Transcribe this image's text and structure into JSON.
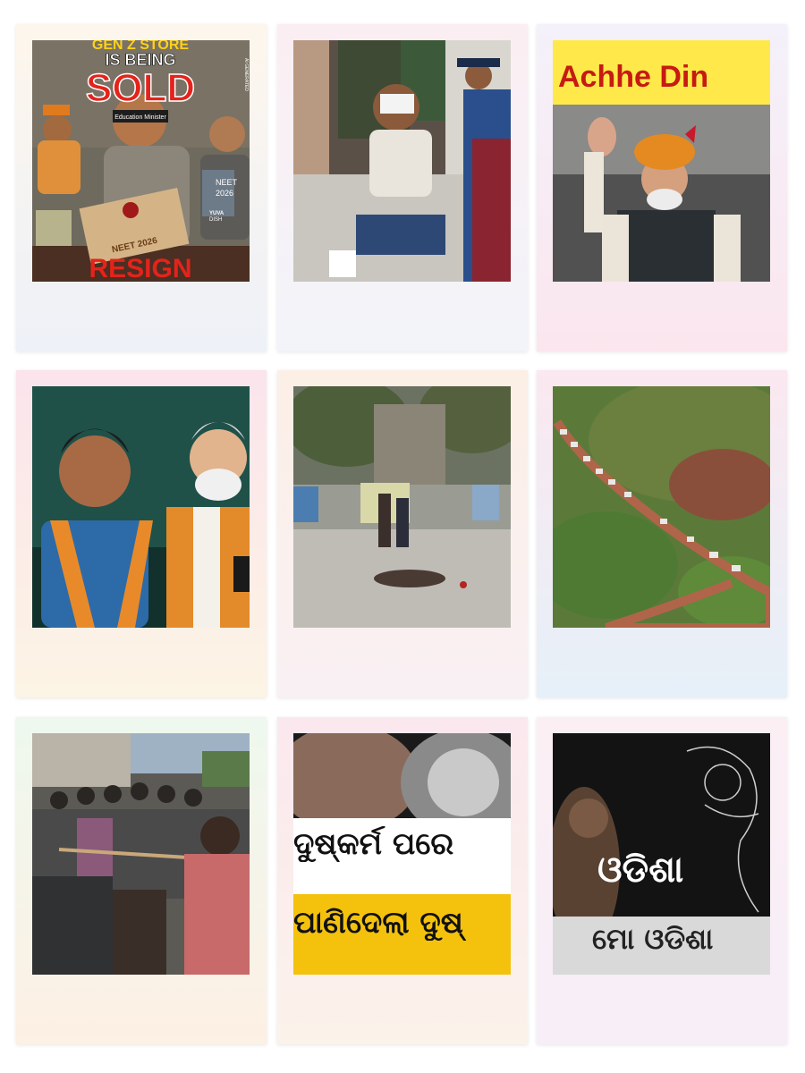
{
  "cards": [
    {
      "headline_top": "GEN Z STORE",
      "headline_mid": "IS BEING",
      "headline_big": "SOLD",
      "blindfold_label": "Education Minister",
      "envelope_label": "NEET 2026",
      "book_label_1": "NEET",
      "book_label_2": "2026",
      "watermark": "AI GENERATED",
      "logo_text_1": "YUVA",
      "logo_text_2": "DISH",
      "footer": "RESIGN"
    },
    {
      "scene": "injured-man-bandaged"
    },
    {
      "banner": "Achhe Din"
    },
    {
      "scene": "two-politicians-portrait"
    },
    {
      "scene": "street-assault"
    },
    {
      "scene": "truck-convoy-hills"
    },
    {
      "scene": "crowd-with-rope"
    },
    {
      "line_1": "ଦୁଷ୍କର୍ମ ପରେ",
      "line_2": "ପାଣିଦେଲା ଦୁଷ୍"
    },
    {
      "line_1": "ଓଡିଶା",
      "line_2": "ମୋ ଓଡିଶା"
    }
  ]
}
